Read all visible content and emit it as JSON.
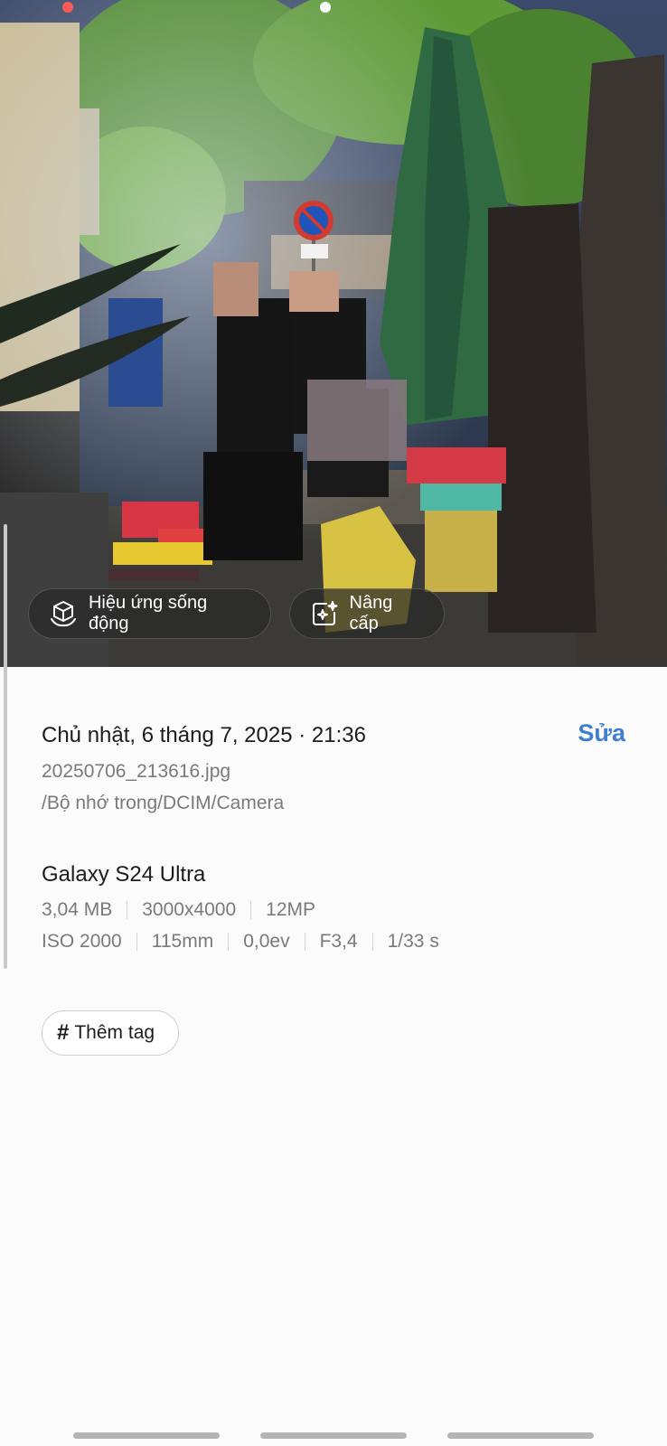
{
  "photo": {
    "chips": {
      "live_effect": {
        "label": "Hiệu ứng sống động",
        "icon": "cube-sparkle-icon"
      },
      "upgrade": {
        "label": "Nâng cấp",
        "icon": "image-sparkle-icon"
      }
    }
  },
  "details": {
    "date": "Chủ nhật, 6 tháng 7, 2025 · 21:36",
    "edit_label": "Sửa",
    "filename": "20250706_213616.jpg",
    "path": "/Bộ nhớ trong/DCIM/Camera",
    "device": "Galaxy S24 Ultra",
    "specs_row1": [
      "3,04 MB",
      "3000x4000",
      "12MP"
    ],
    "specs_row2": [
      "ISO 2000",
      "115mm",
      "0,0ev",
      "F3,4",
      "1/33 s"
    ],
    "tag_button": {
      "icon": "#",
      "label": "Thêm tag"
    }
  },
  "colors": {
    "accent": "#3e7fd0",
    "background": "#fbfbfb"
  }
}
